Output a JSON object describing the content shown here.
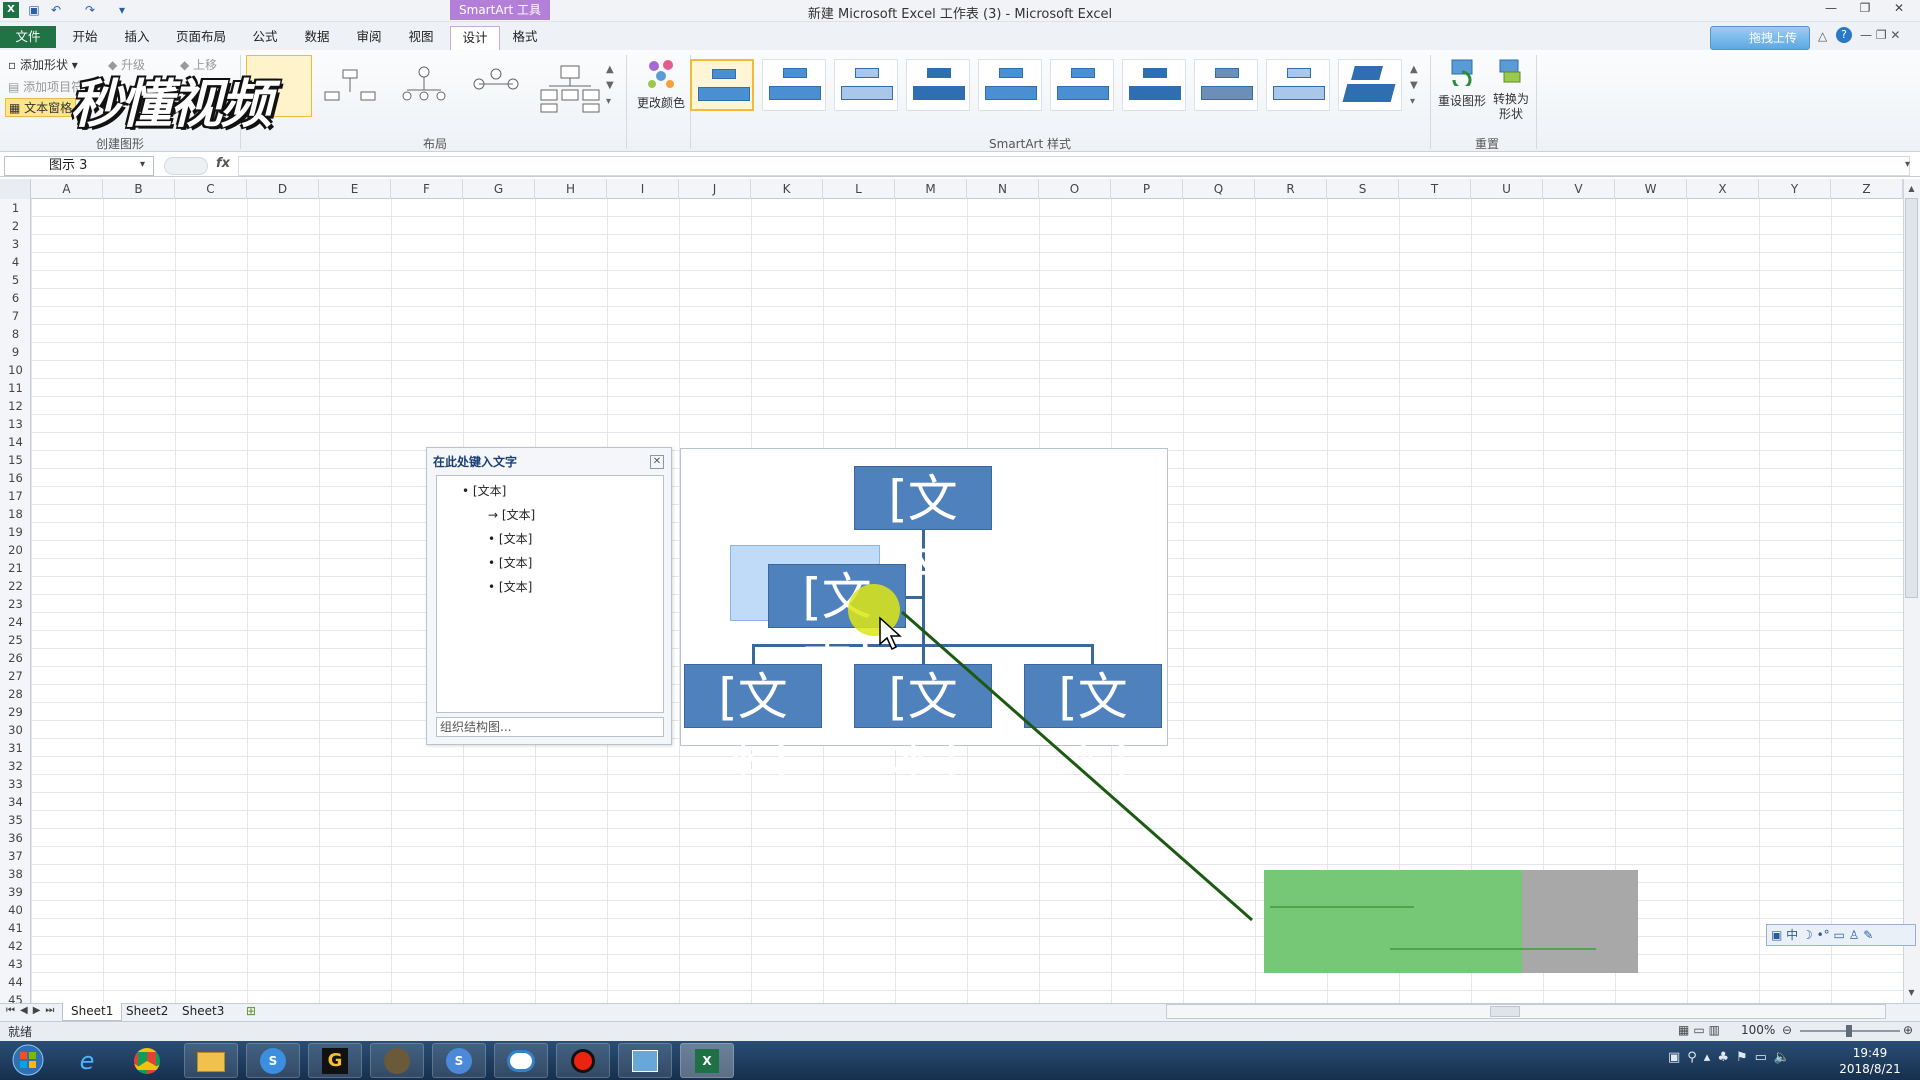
{
  "window": {
    "title": "新建 Microsoft Excel 工作表 (3) - Microsoft Excel"
  },
  "context_tab": "SmartArt 工具",
  "tabs": [
    "文件",
    "开始",
    "插入",
    "页面布局",
    "公式",
    "数据",
    "审阅",
    "视图",
    "设计",
    "格式"
  ],
  "active_tab": "设计",
  "upload_label": "拖拽上传",
  "watermark": "秒懂视频",
  "ribbon": {
    "create_graphic": {
      "add_shape": "添加形状",
      "add_bullet": "添加项目符号",
      "text_pane": "文本窗格",
      "promote": "升级",
      "demote": "降级",
      "move_up": "上移",
      "group": "创建图形"
    },
    "layout_group": "布局",
    "change_colors": "更改颜色",
    "styles_group": "SmartArt 样式",
    "reset_graphic": "重设图形",
    "convert_shape": "转换为形状",
    "reset_group": "重置"
  },
  "formula_bar": {
    "name_box": "图示 3",
    "fx": "fx",
    "value": ""
  },
  "columns": [
    "A",
    "B",
    "C",
    "D",
    "E",
    "F",
    "G",
    "H",
    "I",
    "J",
    "K",
    "L",
    "M",
    "N",
    "O",
    "P",
    "Q",
    "R",
    "S",
    "T",
    "U",
    "V",
    "W",
    "X",
    "Y",
    "Z"
  ],
  "rows": [
    "1",
    "2",
    "3",
    "4",
    "5",
    "6",
    "7",
    "8",
    "9",
    "10",
    "11",
    "12",
    "13",
    "14",
    "15",
    "16",
    "17",
    "18",
    "19",
    "20",
    "21",
    "22",
    "23",
    "24",
    "25",
    "26",
    "27",
    "28",
    "29",
    "30",
    "31",
    "32",
    "33",
    "34",
    "35",
    "36",
    "37",
    "38",
    "39",
    "40",
    "41",
    "42",
    "43",
    "44",
    "45"
  ],
  "text_pane": {
    "title": "在此处键入文字",
    "items": [
      "[文本]",
      "[文本]",
      "[文本]",
      "[文本]",
      "[文本]"
    ],
    "footer": "组织结构图..."
  },
  "smartart": {
    "top": "[文本]",
    "assistant": "[文本]",
    "children": [
      "[文本]",
      "[文本]",
      "[文本]"
    ]
  },
  "sheets": [
    "Sheet1",
    "Sheet2",
    "Sheet3"
  ],
  "status": {
    "ready": "就绪",
    "zoom": "100%"
  },
  "ime": "中",
  "clock": {
    "time": "19:49",
    "date": "2018/8/21"
  }
}
